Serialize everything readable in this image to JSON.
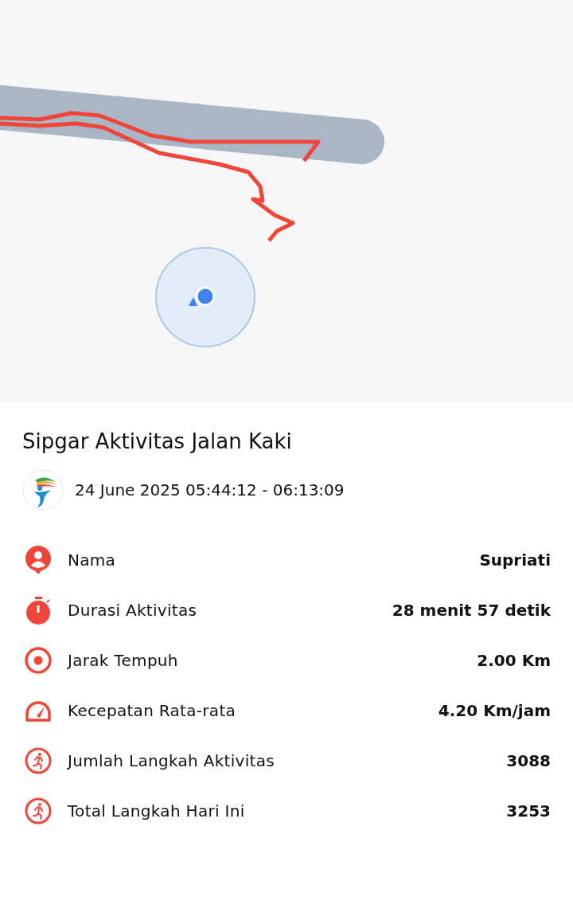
{
  "title": "Sipgar Aktivitas Jalan Kaki",
  "time_range": "24 June 2025 05:44:12 - 06:13:09",
  "stats": [
    {
      "kind": "person",
      "label": "Nama",
      "value": "Supriati"
    },
    {
      "kind": "stopwatch",
      "label": "Durasi Aktivitas",
      "value": "28 menit 57 detik"
    },
    {
      "kind": "target",
      "label": "Jarak Tempuh",
      "value": "2.00 Km"
    },
    {
      "kind": "speed",
      "label": "Kecepatan Rata-rata",
      "value": "4.20 Km/jam"
    },
    {
      "kind": "runner",
      "label": "Jumlah Langkah Aktivitas",
      "value": "3088"
    },
    {
      "kind": "runner",
      "label": "Total Langkah Hari Ini",
      "value": "3253"
    }
  ]
}
